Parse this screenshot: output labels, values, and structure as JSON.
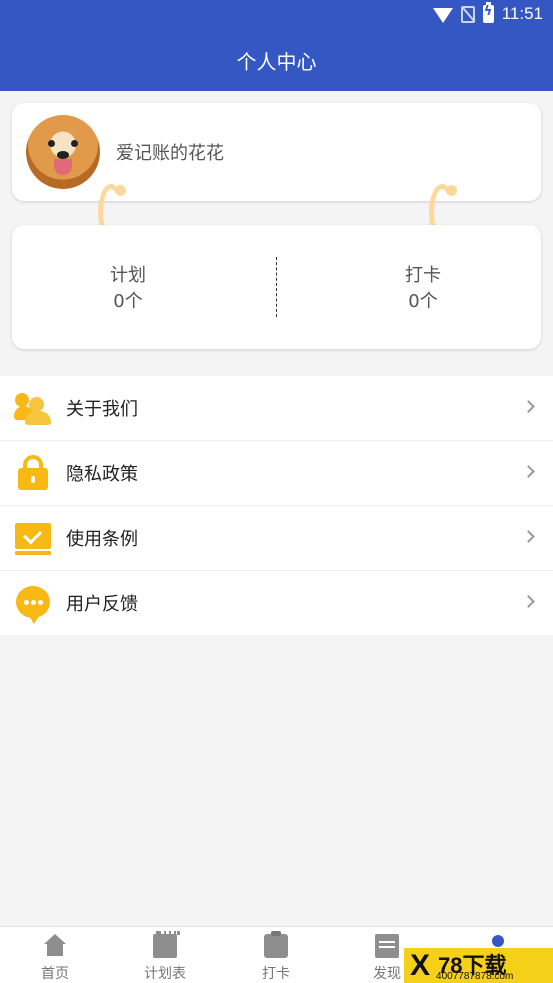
{
  "status_bar": {
    "time": "11:51"
  },
  "header": {
    "title": "个人中心"
  },
  "profile": {
    "username": "爱记账的花花"
  },
  "stats": {
    "plan": {
      "label": "计划",
      "count": "0个"
    },
    "checkin": {
      "label": "打卡",
      "count": "0个"
    }
  },
  "menu": {
    "items": [
      {
        "label": "关于我们",
        "icon": "users-icon"
      },
      {
        "label": "隐私政策",
        "icon": "lock-icon"
      },
      {
        "label": "使用条例",
        "icon": "checked-document-icon"
      },
      {
        "label": "用户反馈",
        "icon": "chat-bubble-icon"
      }
    ]
  },
  "tabbar": {
    "items": [
      {
        "label": "首页",
        "icon": "home-icon"
      },
      {
        "label": "计划表",
        "icon": "calendar-icon"
      },
      {
        "label": "打卡",
        "icon": "clipboard-icon"
      },
      {
        "label": "发现",
        "icon": "document-icon"
      },
      {
        "label": "",
        "icon": "person-icon",
        "active": true
      }
    ]
  },
  "watermark": {
    "big": "78下载",
    "small": "4007787878.com",
    "mark": "X"
  },
  "colors": {
    "primary": "#3457c4",
    "accent_yellow": "#f9b915",
    "ring": "#fcd99a"
  }
}
